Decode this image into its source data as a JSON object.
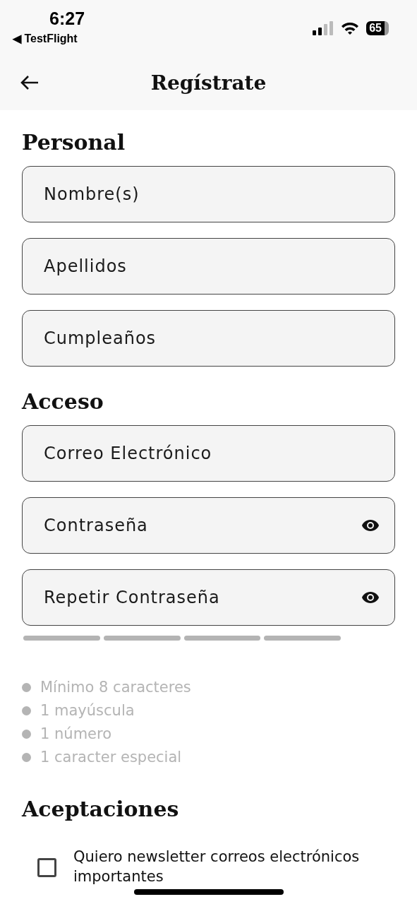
{
  "status_bar": {
    "time": "6:27",
    "back_app": "◀ TestFlight",
    "battery": "65"
  },
  "header": {
    "title": "Regístrate"
  },
  "sections": [
    {
      "title": "Personal",
      "fields": [
        {
          "placeholder": "Nombre(s)",
          "kind": "text"
        },
        {
          "placeholder": "Apellidos",
          "kind": "text"
        },
        {
          "placeholder": "Cumpleaños",
          "kind": "text"
        }
      ]
    },
    {
      "title": "Acceso",
      "fields": [
        {
          "placeholder": "Correo Electrónico",
          "kind": "text"
        },
        {
          "placeholder": "Contraseña",
          "kind": "password"
        },
        {
          "placeholder": "Repetir Contraseña",
          "kind": "password"
        }
      ]
    }
  ],
  "strength_meter": [
    {
      "filled": false
    },
    {
      "filled": false
    },
    {
      "filled": false
    },
    {
      "filled": false
    }
  ],
  "requirements": [
    {
      "label": "Mínimo 8 caracteres",
      "met": false
    },
    {
      "label": "1 mayúscula",
      "met": false
    },
    {
      "label": "1 número",
      "met": false
    },
    {
      "label": "1 caracter especial",
      "met": false
    }
  ],
  "acceptances": {
    "title": "Aceptaciones",
    "items": [
      {
        "label": "Quiero newsletter correos electrónicos importantes",
        "checked": false
      }
    ]
  }
}
